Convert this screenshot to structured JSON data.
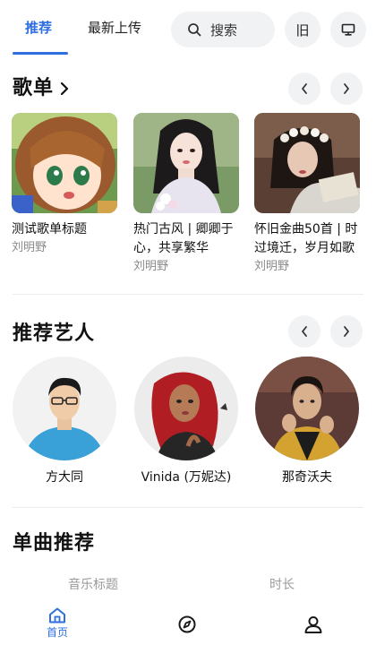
{
  "header": {
    "tabs": [
      {
        "label": "推荐",
        "active": true
      },
      {
        "label": "最新上传",
        "active": false
      }
    ],
    "search_label": "搜索",
    "old_button": "旧",
    "accent_color": "#2f6fe0"
  },
  "playlists": {
    "title": "歌单",
    "items": [
      {
        "title": "测试歌单标题",
        "author": "刘明野",
        "cover": "anime-girl-cover"
      },
      {
        "title": "热门古风 | 卿卿于心，共享繁华",
        "author": "刘明野",
        "cover": "hanfu-girl-cover"
      },
      {
        "title": "怀旧金曲50首 | 时过境迁，岁月如歌",
        "author": "刘明野",
        "cover": "flower-crown-girl-cover"
      }
    ]
  },
  "artists": {
    "title": "推荐艺人",
    "items": [
      {
        "name": "方大同"
      },
      {
        "name": "Vinida (万妮达)"
      },
      {
        "name": "那奇沃夫"
      }
    ]
  },
  "songs": {
    "title": "单曲推荐",
    "columns": [
      "音乐标题",
      "时长"
    ]
  },
  "bottom_nav": {
    "items": [
      {
        "label": "首页",
        "icon": "home-icon",
        "active": true
      },
      {
        "label": "",
        "icon": "compass-icon",
        "active": false
      },
      {
        "label": "",
        "icon": "user-icon",
        "active": false
      }
    ]
  }
}
